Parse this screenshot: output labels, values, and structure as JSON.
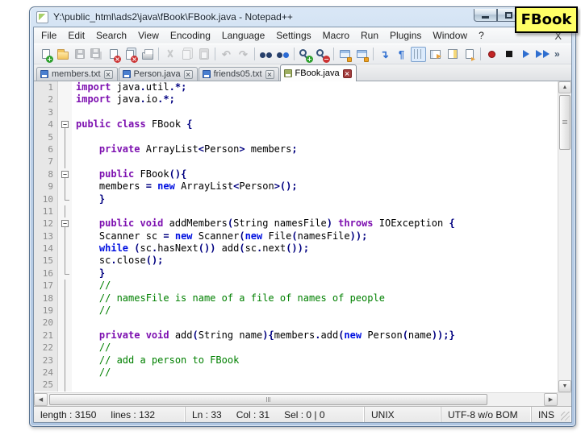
{
  "window": {
    "title": "Y:\\public_html\\ads2\\java\\fBook\\FBook.java - Notepad++"
  },
  "note": {
    "text": "FBook",
    "bg": "#FFFF66"
  },
  "menu": {
    "items": [
      "File",
      "Edit",
      "Search",
      "View",
      "Encoding",
      "Language",
      "Settings",
      "Macro",
      "Run",
      "Plugins",
      "Window",
      "?"
    ],
    "close_label": "X"
  },
  "toolbar": {
    "overflow_label": "»",
    "icons": [
      {
        "name": "new-file-icon",
        "type": "page-new"
      },
      {
        "name": "open-icon",
        "type": "folder"
      },
      {
        "name": "save-icon",
        "type": "floppy",
        "state": "disabled"
      },
      {
        "name": "save-all-icon",
        "type": "floppy-all",
        "state": "disabled"
      },
      {
        "name": "close-icon",
        "type": "page-close"
      },
      {
        "name": "close-all-icon",
        "type": "page-close-all"
      },
      {
        "name": "print-icon",
        "type": "printer"
      },
      {
        "sep": true
      },
      {
        "name": "cut-icon",
        "type": "scissors",
        "state": "disabled"
      },
      {
        "name": "copy-icon",
        "type": "copy",
        "state": "disabled"
      },
      {
        "name": "paste-icon",
        "type": "paste",
        "state": "disabled"
      },
      {
        "sep": true
      },
      {
        "name": "undo-icon",
        "type": "undo",
        "state": "disabled"
      },
      {
        "name": "redo-icon",
        "type": "redo",
        "state": "disabled"
      },
      {
        "sep": true
      },
      {
        "name": "find-icon",
        "type": "find"
      },
      {
        "name": "replace-icon",
        "type": "replace"
      },
      {
        "sep": true
      },
      {
        "name": "zoom-in-icon",
        "type": "zoom-in"
      },
      {
        "name": "zoom-out-icon",
        "type": "zoom-out"
      },
      {
        "sep": true
      },
      {
        "name": "sync-vertical-icon",
        "type": "sync"
      },
      {
        "name": "sync-horizontal-icon",
        "type": "sync"
      },
      {
        "sep": true
      },
      {
        "name": "word-wrap-icon",
        "type": "wrap"
      },
      {
        "name": "show-all-characters-icon",
        "type": "pilcrow"
      },
      {
        "name": "indent-guide-icon",
        "type": "indent",
        "state": "pressed"
      },
      {
        "name": "function-list-icon",
        "type": "panel"
      },
      {
        "name": "document-map-icon",
        "type": "map"
      },
      {
        "name": "doc-switcher-icon",
        "type": "switcher"
      },
      {
        "sep": true
      },
      {
        "name": "record-macro-icon",
        "type": "record"
      },
      {
        "name": "stop-record-icon",
        "type": "stop"
      },
      {
        "name": "playback-macro-icon",
        "type": "play"
      },
      {
        "name": "run-macro-multiple-icon",
        "type": "multi-play"
      }
    ]
  },
  "tabs": [
    {
      "label": "members.txt",
      "active": false
    },
    {
      "label": "Person.java",
      "active": false
    },
    {
      "label": "friends05.txt",
      "active": false
    },
    {
      "label": "FBook.java",
      "active": true
    }
  ],
  "editor": {
    "lines": [
      {
        "n": 1,
        "fold": "none",
        "seg": [
          [
            "k1",
            "import"
          ],
          [
            "t",
            " java"
          ],
          [
            "op",
            "."
          ],
          [
            "t",
            "util"
          ],
          [
            "op",
            ".*;"
          ]
        ]
      },
      {
        "n": 2,
        "fold": "none",
        "seg": [
          [
            "k1",
            "import"
          ],
          [
            "t",
            " java"
          ],
          [
            "op",
            "."
          ],
          [
            "t",
            "io"
          ],
          [
            "op",
            ".*;"
          ]
        ]
      },
      {
        "n": 3,
        "fold": "none",
        "seg": []
      },
      {
        "n": 4,
        "fold": "box",
        "seg": [
          [
            "k1",
            "public class"
          ],
          [
            "t",
            " FBook "
          ],
          [
            "op",
            "{"
          ]
        ]
      },
      {
        "n": 5,
        "fold": "line",
        "seg": []
      },
      {
        "n": 6,
        "fold": "line",
        "seg": [
          [
            "t",
            "    "
          ],
          [
            "k1",
            "private"
          ],
          [
            "t",
            " ArrayList"
          ],
          [
            "op",
            "<"
          ],
          [
            "t",
            "Person"
          ],
          [
            "op",
            ">"
          ],
          [
            "t",
            " members"
          ],
          [
            "op",
            ";"
          ]
        ]
      },
      {
        "n": 7,
        "fold": "line",
        "seg": []
      },
      {
        "n": 8,
        "fold": "box",
        "seg": [
          [
            "t",
            "    "
          ],
          [
            "k1",
            "public"
          ],
          [
            "t",
            " FBook"
          ],
          [
            "op",
            "(){"
          ]
        ]
      },
      {
        "n": 9,
        "fold": "line",
        "seg": [
          [
            "t",
            "    members "
          ],
          [
            "op",
            "="
          ],
          [
            "t",
            " "
          ],
          [
            "k2",
            "new"
          ],
          [
            "t",
            " ArrayList"
          ],
          [
            "op",
            "<"
          ],
          [
            "t",
            "Person"
          ],
          [
            "op",
            ">();"
          ]
        ]
      },
      {
        "n": 10,
        "fold": "end",
        "seg": [
          [
            "t",
            "    "
          ],
          [
            "op",
            "}"
          ]
        ]
      },
      {
        "n": 11,
        "fold": "line",
        "seg": []
      },
      {
        "n": 12,
        "fold": "box",
        "seg": [
          [
            "t",
            "    "
          ],
          [
            "k1",
            "public void"
          ],
          [
            "t",
            " addMembers"
          ],
          [
            "op",
            "("
          ],
          [
            "t",
            "String namesFile"
          ],
          [
            "op",
            ")"
          ],
          [
            "t",
            " "
          ],
          [
            "k1",
            "throws"
          ],
          [
            "t",
            " IOException "
          ],
          [
            "op",
            "{"
          ]
        ]
      },
      {
        "n": 13,
        "fold": "line",
        "seg": [
          [
            "t",
            "    Scanner sc "
          ],
          [
            "op",
            "="
          ],
          [
            "t",
            " "
          ],
          [
            "k2",
            "new"
          ],
          [
            "t",
            " Scanner"
          ],
          [
            "op",
            "("
          ],
          [
            "k2",
            "new"
          ],
          [
            "t",
            " File"
          ],
          [
            "op",
            "("
          ],
          [
            "t",
            "namesFile"
          ],
          [
            "op",
            "));"
          ]
        ]
      },
      {
        "n": 14,
        "fold": "line",
        "seg": [
          [
            "t",
            "    "
          ],
          [
            "k2",
            "while"
          ],
          [
            "t",
            " "
          ],
          [
            "op",
            "("
          ],
          [
            "t",
            "sc"
          ],
          [
            "op",
            "."
          ],
          [
            "t",
            "hasNext"
          ],
          [
            "op",
            "())"
          ],
          [
            "t",
            " add"
          ],
          [
            "op",
            "("
          ],
          [
            "t",
            "sc"
          ],
          [
            "op",
            "."
          ],
          [
            "t",
            "next"
          ],
          [
            "op",
            "());"
          ]
        ]
      },
      {
        "n": 15,
        "fold": "line",
        "seg": [
          [
            "t",
            "    sc"
          ],
          [
            "op",
            "."
          ],
          [
            "t",
            "close"
          ],
          [
            "op",
            "();"
          ]
        ]
      },
      {
        "n": 16,
        "fold": "end",
        "seg": [
          [
            "t",
            "    "
          ],
          [
            "op",
            "}"
          ]
        ]
      },
      {
        "n": 17,
        "fold": "line",
        "seg": [
          [
            "t",
            "    "
          ],
          [
            "cm",
            "//"
          ]
        ]
      },
      {
        "n": 18,
        "fold": "line",
        "seg": [
          [
            "t",
            "    "
          ],
          [
            "cm",
            "// namesFile is name of a file of names of people"
          ]
        ]
      },
      {
        "n": 19,
        "fold": "line",
        "seg": [
          [
            "t",
            "    "
          ],
          [
            "cm",
            "//"
          ]
        ]
      },
      {
        "n": 20,
        "fold": "line",
        "seg": []
      },
      {
        "n": 21,
        "fold": "line",
        "seg": [
          [
            "t",
            "    "
          ],
          [
            "k1",
            "private void"
          ],
          [
            "t",
            " add"
          ],
          [
            "op",
            "("
          ],
          [
            "t",
            "String name"
          ],
          [
            "op",
            "){"
          ],
          [
            "t",
            "members"
          ],
          [
            "op",
            "."
          ],
          [
            "t",
            "add"
          ],
          [
            "op",
            "("
          ],
          [
            "k2",
            "new"
          ],
          [
            "t",
            " Person"
          ],
          [
            "op",
            "("
          ],
          [
            "t",
            "name"
          ],
          [
            "op",
            "));}"
          ]
        ]
      },
      {
        "n": 22,
        "fold": "line",
        "seg": [
          [
            "t",
            "    "
          ],
          [
            "cm",
            "//"
          ]
        ]
      },
      {
        "n": 23,
        "fold": "line",
        "seg": [
          [
            "t",
            "    "
          ],
          [
            "cm",
            "// add a person to FBook"
          ]
        ]
      },
      {
        "n": 24,
        "fold": "line",
        "seg": [
          [
            "t",
            "    "
          ],
          [
            "cm",
            "//"
          ]
        ]
      },
      {
        "n": 25,
        "fold": "line",
        "seg": []
      }
    ]
  },
  "statusbar": {
    "length": "length : 3150",
    "lines": "lines : 132",
    "ln": "Ln : 33",
    "col": "Col : 31",
    "sel": "Sel : 0 | 0",
    "eol": "UNIX",
    "encoding": "UTF-8 w/o BOM",
    "ins": "INS"
  }
}
